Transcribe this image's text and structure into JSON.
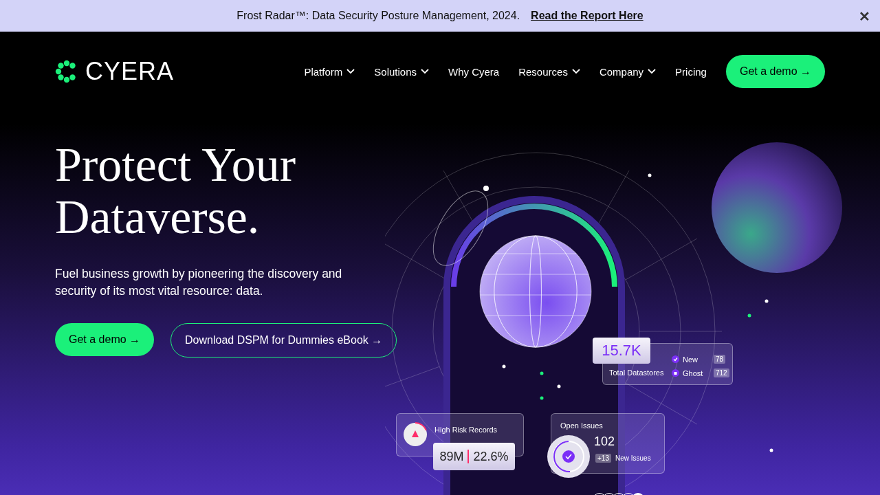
{
  "banner": {
    "text": "Frost Radar™: Data Security Posture Management, 2024.",
    "link": "Read the Report Here",
    "close": "✕"
  },
  "header": {
    "logo": "CYERA",
    "nav": [
      {
        "label": "Platform",
        "dropdown": true
      },
      {
        "label": "Solutions",
        "dropdown": true
      },
      {
        "label": "Why Cyera",
        "dropdown": false
      },
      {
        "label": "Resources",
        "dropdown": true
      },
      {
        "label": "Company",
        "dropdown": true
      },
      {
        "label": "Pricing",
        "dropdown": false
      }
    ],
    "cta": "Get a demo →"
  },
  "hero": {
    "title_lines": [
      "Protect Your",
      "Dataverse."
    ],
    "subtitle": "Fuel business growth by pioneering the discovery and security of its most vital resource: data.",
    "primary_button": "Get a demo →",
    "secondary_button": "Download DSPM for Dummies eBook →"
  },
  "datastores": {
    "value": "15.7K",
    "label": "Total Datastores",
    "legend": [
      {
        "label": "New",
        "count": "78",
        "kind": "check"
      },
      {
        "label": "Ghost",
        "count": "712",
        "kind": "ghost"
      }
    ]
  },
  "risk": {
    "label": "High Risk Records",
    "count": "89M",
    "percent": "22.6%"
  },
  "issues": {
    "label": "Open Issues",
    "value": "102",
    "delta": "+13",
    "delta_label": "New Issues"
  },
  "carousel": [
    {
      "selected": false
    },
    {
      "selected": false
    },
    {
      "selected": false
    },
    {
      "selected": false
    },
    {
      "selected": true
    }
  ]
}
